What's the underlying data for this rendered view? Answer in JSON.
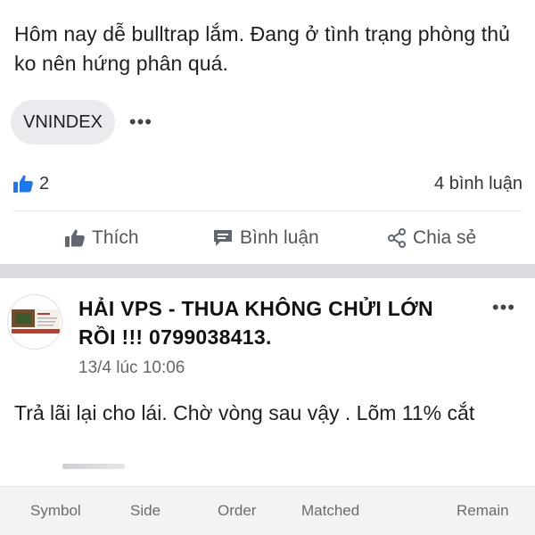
{
  "post1": {
    "text": "Hôm nay dễ bulltrap lắm. Đang ở tình trạng phòng thủ ko nên hứng phân quá.",
    "tag": "VNINDEX",
    "more_glyph": "•••",
    "like_count": "2",
    "comment_count": "4 bình luận",
    "actions": {
      "like": "Thích",
      "comment": "Bình luận",
      "share": "Chia sẻ"
    }
  },
  "post2": {
    "author": "HẢI VPS - THUA KHÔNG CHỬI LỚN RỒI !!! 0799038413.",
    "timestamp": "13/4 lúc 10:06",
    "text": "Trả lãi lại cho lái. Chờ vòng sau vậy . Lõm 11% cắt",
    "more_glyph": "•••"
  },
  "table_header": {
    "symbol": "Symbol",
    "side": "Side",
    "order": "Order",
    "matched": "Matched",
    "remain": "Remain"
  },
  "colors": {
    "like_blue": "#1877f2",
    "icon_gray": "#606770",
    "separator": "#dcdde1",
    "chip_bg": "#e9ebee"
  }
}
